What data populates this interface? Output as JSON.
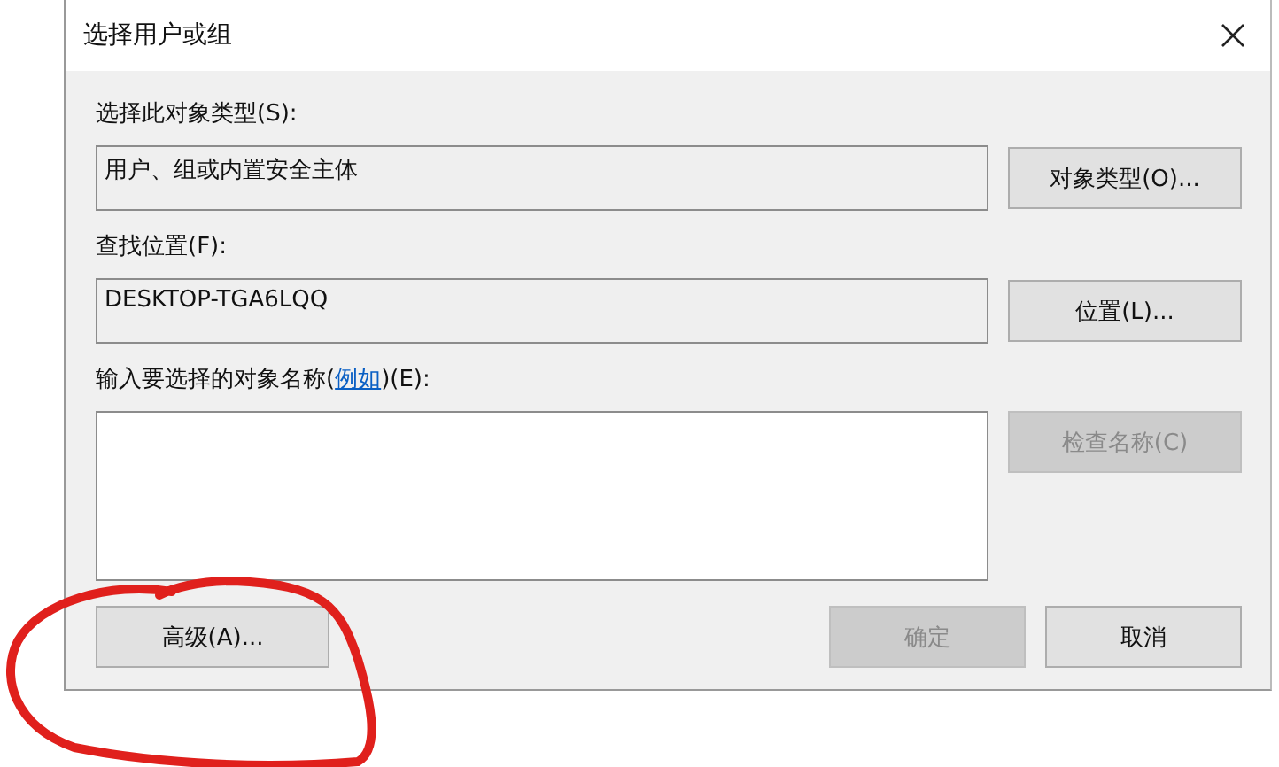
{
  "window": {
    "title": "选择用户或组"
  },
  "object_type": {
    "label": "选择此对象类型(S):",
    "value": "用户、组或内置安全主体",
    "button": {
      "label": "对象类型(O)...",
      "disabled": false
    }
  },
  "location": {
    "label": "查找位置(F):",
    "value": "DESKTOP-TGA6LQQ",
    "button": {
      "label": "位置(L)...",
      "disabled": false
    }
  },
  "names": {
    "label_before": "输入要选择的对象名称(",
    "link": "例如",
    "label_after": ")(E):",
    "button": {
      "label": "检查名称(C)",
      "disabled": true
    }
  },
  "buttons": [
    {
      "label": "高级(A)...",
      "disabled": false
    },
    {
      "label": "确定",
      "disabled": true
    },
    {
      "label": "取消",
      "disabled": false
    }
  ]
}
